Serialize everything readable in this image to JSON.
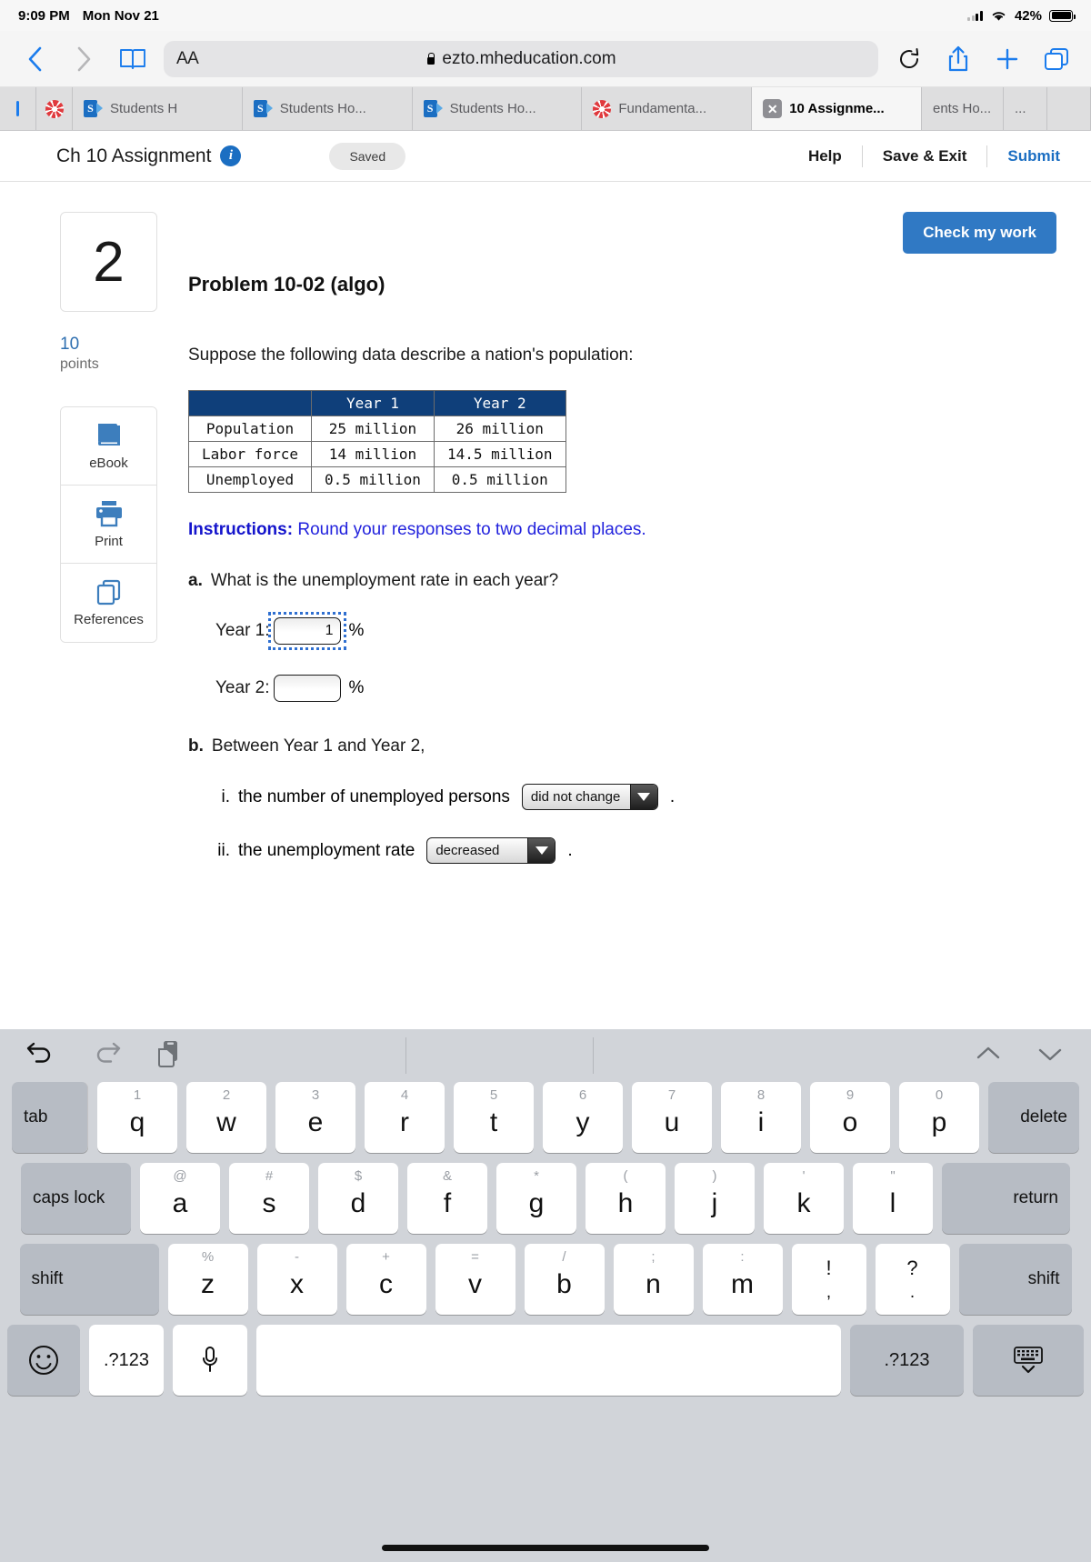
{
  "status_bar": {
    "time": "9:09 PM",
    "date": "Mon Nov 21",
    "battery": "42%"
  },
  "browser": {
    "aa_label": "AA",
    "url": "ezto.mheducation.com",
    "tabs": [
      {
        "label": "Students H",
        "icon": "sharepoint-icon",
        "active": false,
        "style": "grow"
      },
      {
        "label": "Students Ho...",
        "icon": "sharepoint-icon",
        "active": false,
        "style": "grow"
      },
      {
        "label": "Students Ho...",
        "icon": "sharepoint-icon",
        "active": false,
        "style": "grow"
      },
      {
        "label": "Fundamenta...",
        "icon": "canvas-icon",
        "active": false,
        "style": "grow"
      },
      {
        "label": "10 Assignme...",
        "icon": "close-icon",
        "active": true,
        "style": "grow"
      },
      {
        "label": "ents Ho...",
        "icon": "none",
        "active": false,
        "style": "clipped"
      },
      {
        "label": "...",
        "icon": "none",
        "active": false,
        "style": "tiny"
      }
    ]
  },
  "assignment_header": {
    "title": "Ch 10 Assignment",
    "info_icon_label": "i",
    "saved_label": "Saved",
    "help_label": "Help",
    "save_exit_label": "Save & Exit",
    "submit_label": "Submit"
  },
  "content": {
    "check_my_work_label": "Check my work",
    "question_number": "2",
    "points_value": "10",
    "points_label": "points",
    "tools": [
      {
        "label": "eBook",
        "icon": "book-icon"
      },
      {
        "label": "Print",
        "icon": "printer-icon"
      },
      {
        "label": "References",
        "icon": "documents-icon"
      }
    ],
    "problem_title": "Problem 10-02 (algo)",
    "prompt": "Suppose the following data describe a nation's population:",
    "instructions_label": "Instructions:",
    "instructions_text": " Round your responses to two decimal places.",
    "part_a": {
      "label": "a.",
      "text": "What is the unemployment rate in each year?",
      "year1_label": "Year 1:",
      "year1_value": "1",
      "year2_label": "Year 2:",
      "year2_value": "",
      "percent_symbol": "%"
    },
    "part_b": {
      "label": "b.",
      "text": "Between Year 1 and Year 2,",
      "items": [
        {
          "numeral": "i.",
          "text": "the number of unemployed persons",
          "selected": "did not change",
          "period": "."
        },
        {
          "numeral": "ii.",
          "text": "the unemployment rate",
          "selected": "decreased",
          "period": "."
        }
      ]
    }
  },
  "chart_data": {
    "type": "table",
    "title": "Suppose the following data describe a nation's population:",
    "columns": [
      "",
      "Year 1",
      "Year 2"
    ],
    "rows": [
      [
        "Population",
        "25 million",
        "26 million"
      ],
      [
        "Labor force",
        "14 million",
        "14.5 million"
      ],
      [
        "Unemployed",
        "0.5 million",
        "0.5 million"
      ]
    ],
    "header_color": "#0f3f7a"
  },
  "keyboard": {
    "toolbar_icons": [
      "undo-icon",
      "redo-icon",
      "paste-icon",
      "chevron-up-icon",
      "chevron-down-icon"
    ],
    "row1": [
      {
        "main": "tab",
        "sup": "",
        "type": "mod tab"
      },
      {
        "main": "q",
        "sup": "1",
        "type": ""
      },
      {
        "main": "w",
        "sup": "2",
        "type": ""
      },
      {
        "main": "e",
        "sup": "3",
        "type": ""
      },
      {
        "main": "r",
        "sup": "4",
        "type": ""
      },
      {
        "main": "t",
        "sup": "5",
        "type": ""
      },
      {
        "main": "y",
        "sup": "6",
        "type": ""
      },
      {
        "main": "u",
        "sup": "7",
        "type": ""
      },
      {
        "main": "i",
        "sup": "8",
        "type": ""
      },
      {
        "main": "o",
        "sup": "9",
        "type": ""
      },
      {
        "main": "p",
        "sup": "0",
        "type": ""
      },
      {
        "main": "delete",
        "sup": "",
        "type": "mod del"
      }
    ],
    "row2": [
      {
        "main": "caps lock",
        "sup": "",
        "type": "mod caps"
      },
      {
        "main": "a",
        "sup": "@",
        "type": ""
      },
      {
        "main": "s",
        "sup": "#",
        "type": ""
      },
      {
        "main": "d",
        "sup": "$",
        "type": ""
      },
      {
        "main": "f",
        "sup": "&",
        "type": ""
      },
      {
        "main": "g",
        "sup": "*",
        "type": ""
      },
      {
        "main": "h",
        "sup": "(",
        "type": ""
      },
      {
        "main": "j",
        "sup": ")",
        "type": ""
      },
      {
        "main": "k",
        "sup": "'",
        "type": ""
      },
      {
        "main": "l",
        "sup": "\"",
        "type": ""
      },
      {
        "main": "return",
        "sup": "",
        "type": "mod ret"
      }
    ],
    "row3": [
      {
        "main": "shift",
        "sup": "",
        "type": "mod shift-l"
      },
      {
        "main": "z",
        "sup": "%",
        "type": ""
      },
      {
        "main": "x",
        "sup": "-",
        "type": ""
      },
      {
        "main": "c",
        "sup": "+",
        "type": ""
      },
      {
        "main": "v",
        "sup": "=",
        "type": ""
      },
      {
        "main": "b",
        "sup": "/",
        "type": ""
      },
      {
        "main": "n",
        "sup": ";",
        "type": ""
      },
      {
        "main": "m",
        "sup": ":",
        "type": ""
      },
      {
        "main": "!",
        "sup": "",
        "type": "sym",
        "sub": ","
      },
      {
        "main": "?",
        "sup": "",
        "type": "sym",
        "sub": "."
      },
      {
        "main": "shift",
        "sup": "",
        "type": "mod shift-r"
      }
    ],
    "row4": {
      "emoji": "emoji-icon",
      "num_left": ".?123",
      "mic": "microphone-icon",
      "space": "",
      "num_right": ".?123",
      "hide": "hide-keyboard-icon"
    }
  }
}
